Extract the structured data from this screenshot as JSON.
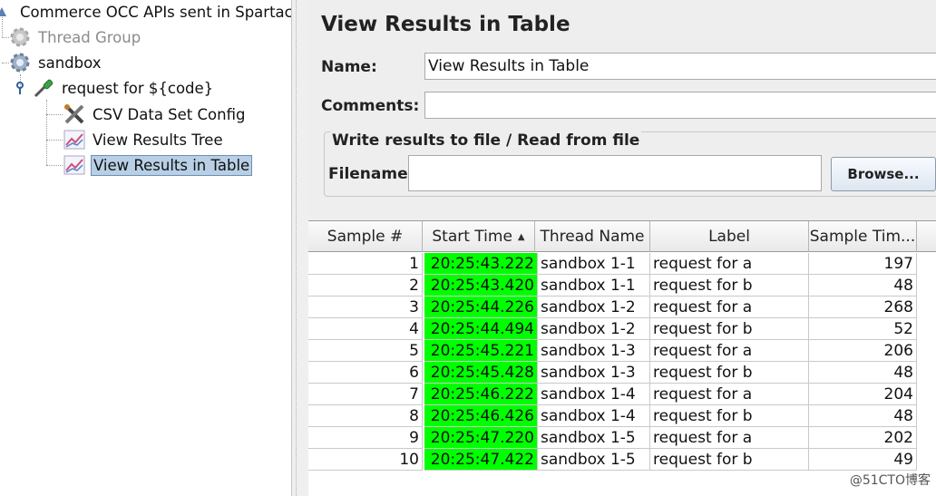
{
  "tree": {
    "root": "Commerce OCC APIs sent in Spartacu",
    "thread_group": "Thread Group",
    "sandbox": "sandbox",
    "request": "request for ${code}",
    "csv": "CSV Data Set Config",
    "results_tree": "View Results Tree",
    "results_table": "View Results in Table"
  },
  "panel": {
    "title": "View Results in Table",
    "name_label": "Name:",
    "name_value": "View Results in Table",
    "comments_label": "Comments:",
    "comments_value": "",
    "file_group_title": "Write results to file / Read from file",
    "filename_label": "Filename",
    "filename_value": "",
    "browse_label": "Browse..."
  },
  "table": {
    "headers": [
      "Sample #",
      "Start Time",
      "Thread Name",
      "Label",
      "Sample Tim..."
    ],
    "sort_column": "Start Time",
    "highlight_color": "#00ff00",
    "rows": [
      [
        "1",
        "20:25:43.222",
        "sandbox 1-1",
        "request for a",
        "197"
      ],
      [
        "2",
        "20:25:43.420",
        "sandbox 1-1",
        "request for b",
        "48"
      ],
      [
        "3",
        "20:25:44.226",
        "sandbox 1-2",
        "request for a",
        "268"
      ],
      [
        "4",
        "20:25:44.494",
        "sandbox 1-2",
        "request for b",
        "52"
      ],
      [
        "5",
        "20:25:45.221",
        "sandbox 1-3",
        "request for a",
        "206"
      ],
      [
        "6",
        "20:25:45.428",
        "sandbox 1-3",
        "request for b",
        "48"
      ],
      [
        "7",
        "20:25:46.222",
        "sandbox 1-4",
        "request for a",
        "204"
      ],
      [
        "8",
        "20:25:46.426",
        "sandbox 1-4",
        "request for b",
        "48"
      ],
      [
        "9",
        "20:25:47.220",
        "sandbox 1-5",
        "request for a",
        "202"
      ],
      [
        "10",
        "20:25:47.422",
        "sandbox 1-5",
        "request for b",
        "49"
      ]
    ]
  },
  "watermark": "@51CTO博客",
  "icons": {
    "root": "test-plan-icon",
    "thread_group": "gear-icon",
    "sandbox": "gear-icon",
    "request": "pipette-icon",
    "csv": "tools-icon",
    "results": "graph-icon"
  }
}
